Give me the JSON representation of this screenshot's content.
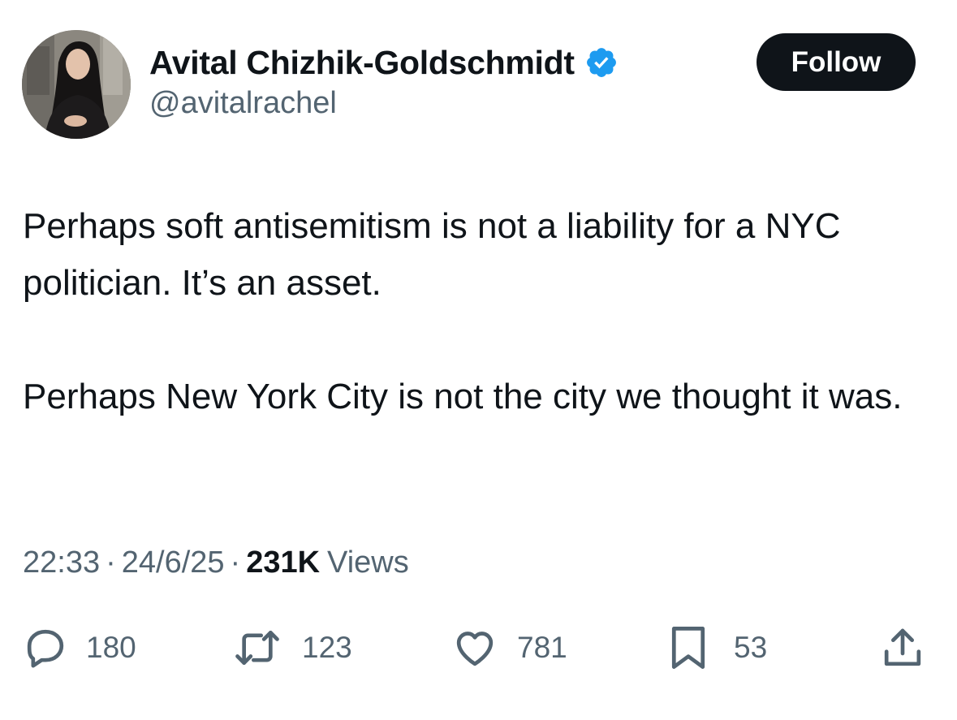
{
  "author": {
    "display_name": "Avital Chizhik-Goldschmidt",
    "handle": "@avitalrachel",
    "verified": true
  },
  "follow_button": {
    "label": "Follow"
  },
  "tweet": {
    "paragraphs": [
      "Perhaps soft antisemitism is not a liability for a NYC politician. It’s an asset.",
      "Perhaps New York City is not the city we thought it was."
    ]
  },
  "meta": {
    "time": "22:33",
    "separator": "·",
    "date": "24/6/25",
    "views_count": "231K",
    "views_label": "Views"
  },
  "actions": {
    "replies": {
      "icon": "reply-icon",
      "count": "180"
    },
    "reposts": {
      "icon": "repost-icon",
      "count": "123"
    },
    "likes": {
      "icon": "heart-icon",
      "count": "781"
    },
    "bookmarks": {
      "icon": "bookmark-icon",
      "count": "53"
    },
    "share": {
      "icon": "share-icon"
    }
  },
  "colors": {
    "primary_text": "#0f1419",
    "secondary_text": "#536471",
    "verified_blue": "#1d9bf0",
    "follow_button_bg": "#0f1419",
    "background": "#ffffff"
  }
}
